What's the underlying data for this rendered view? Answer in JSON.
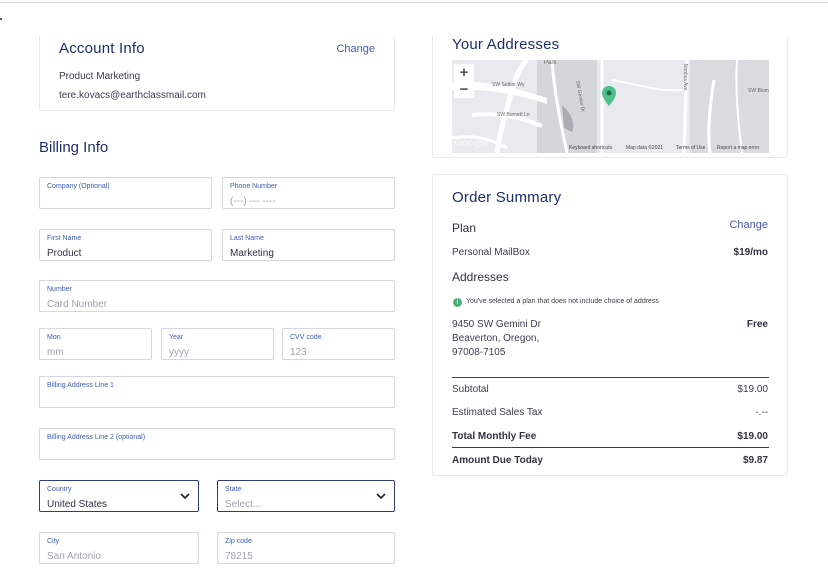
{
  "account": {
    "title": "Account Info",
    "change_label": "Change",
    "name": "Product Marketing",
    "email": "tere.kovacs@earthclassmail.com"
  },
  "billing": {
    "title": "Billing Info",
    "company": {
      "label": "Company (Optional)",
      "value": ""
    },
    "phone": {
      "label": "Phone Number",
      "placeholder": "(---) --- ----"
    },
    "first_name": {
      "label": "First Name",
      "value": "Product"
    },
    "last_name": {
      "label": "Last Name",
      "value": "Marketing"
    },
    "card_number": {
      "label": "Number",
      "placeholder": "Card Number"
    },
    "month": {
      "label": "Mon",
      "placeholder": "mm"
    },
    "year": {
      "label": "Year",
      "placeholder": "yyyy"
    },
    "cvv": {
      "label": "CVV code",
      "placeholder": "123"
    },
    "address1": {
      "label": "Billing Address Line 1"
    },
    "address2": {
      "label": "Billing Address Line 2 (optional)"
    },
    "country": {
      "label": "Country",
      "value": "United States"
    },
    "state": {
      "label": "State",
      "placeholder": "Select..."
    },
    "city": {
      "label": "City",
      "placeholder": "San Antonio"
    },
    "zip": {
      "label": "Zip code",
      "placeholder": "78215"
    }
  },
  "addresses": {
    "title": "Your Addresses",
    "map": {
      "footer_shortcuts": "Keyboard shortcuts",
      "footer_data": "Map data ©2021",
      "footer_terms": "Terms of Use",
      "footer_report": "Report a map error",
      "logo": "Google",
      "streets": [
        "SW Settler Wy",
        "SW Burnett Ln",
        "Park",
        "Nimbus Ave",
        "SW Gemini Dr",
        "SW Blum"
      ]
    }
  },
  "order": {
    "title": "Order Summary",
    "plan_heading": "Plan",
    "change_label": "Change",
    "plan_name": "Personal MailBox",
    "plan_price": "$19/mo",
    "addresses_heading": "Addresses",
    "notice": "You've selected a plan that does not include choice of address",
    "address_line1": "9450 SW Gemini Dr",
    "address_line2": "Beaverton, Oregon,",
    "address_line3": "97008-7105",
    "address_price": "Free",
    "subtotal_label": "Subtotal",
    "subtotal_value": "$19.00",
    "tax_label": "Estimated Sales Tax",
    "tax_value": "-.--",
    "monthly_label": "Total Monthly Fee",
    "monthly_value": "$19.00",
    "due_label": "Amount Due Today",
    "due_value": "$9.87"
  },
  "colors": {
    "accent": "#1f2d6b",
    "label": "#3f5eb5",
    "pin": "#4fbf8b"
  },
  "icons": {
    "zoom_in": "plus-icon",
    "zoom_out": "minus-icon",
    "pin": "map-pin-icon",
    "dropdown": "chevron-down-icon",
    "info": "info-icon"
  }
}
